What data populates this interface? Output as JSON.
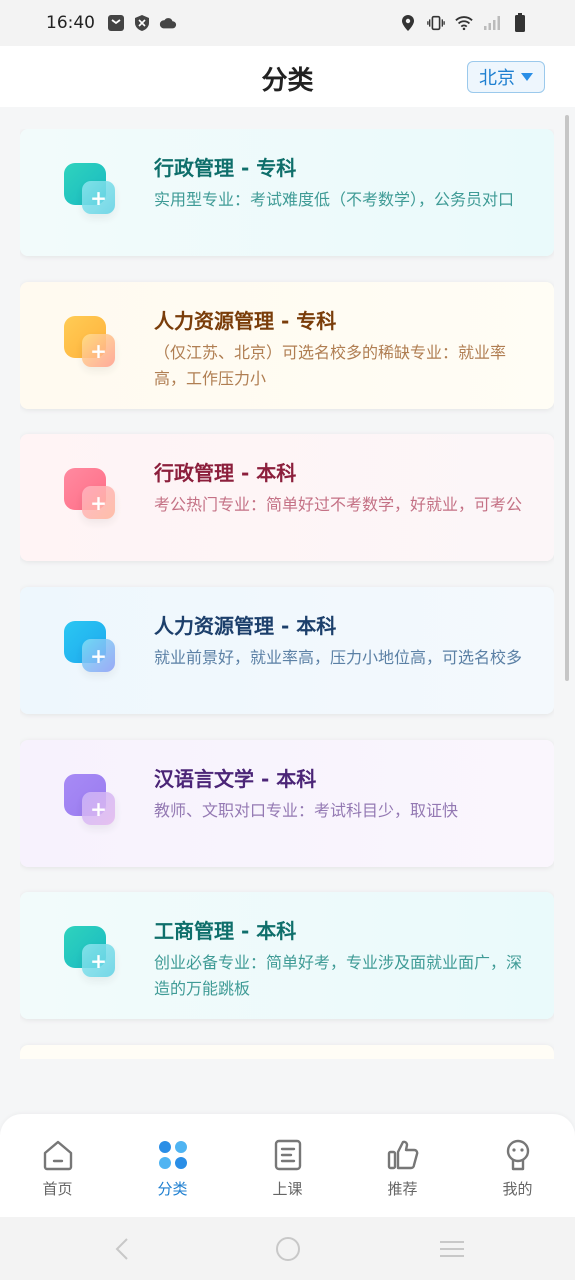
{
  "status_bar": {
    "time": "16:40"
  },
  "header": {
    "title": "分类",
    "city": "北京"
  },
  "cards": [
    {
      "title": "行政管理 - 专科",
      "desc": "实用型专业：考试难度低（不考数学），公务员对口",
      "theme": "teal"
    },
    {
      "title": "人力资源管理 - 专科",
      "desc": "（仅江苏、北京）可选名校多的稀缺专业：就业率高，工作压力小",
      "theme": "orange"
    },
    {
      "title": "行政管理 - 本科",
      "desc": "考公热门专业：简单好过不考数学，好就业，可考公",
      "theme": "pink"
    },
    {
      "title": "人力资源管理 - 本科",
      "desc": "就业前景好，就业率高，压力小地位高，可选名校多",
      "theme": "blue"
    },
    {
      "title": "汉语言文学 - 本科",
      "desc": "教师、文职对口专业：考试科目少，取证快",
      "theme": "purple"
    },
    {
      "title": "工商管理 - 本科",
      "desc": "创业必备专业：简单好考，专业涉及面就业面广，深造的万能跳板",
      "theme": "teal"
    }
  ],
  "tabs": [
    {
      "label": "首页",
      "icon": "home-icon"
    },
    {
      "label": "分类",
      "icon": "category-icon",
      "active": true
    },
    {
      "label": "上课",
      "icon": "course-icon"
    },
    {
      "label": "推荐",
      "icon": "thumbs-up-icon"
    },
    {
      "label": "我的",
      "icon": "profile-icon"
    }
  ],
  "colors": {
    "accent": "#1e7fd0",
    "teal": "#0f6f6b",
    "orange": "#7a3d0a",
    "pink": "#8c1f3c",
    "blue": "#1c3f6b",
    "purple": "#4b2577"
  }
}
